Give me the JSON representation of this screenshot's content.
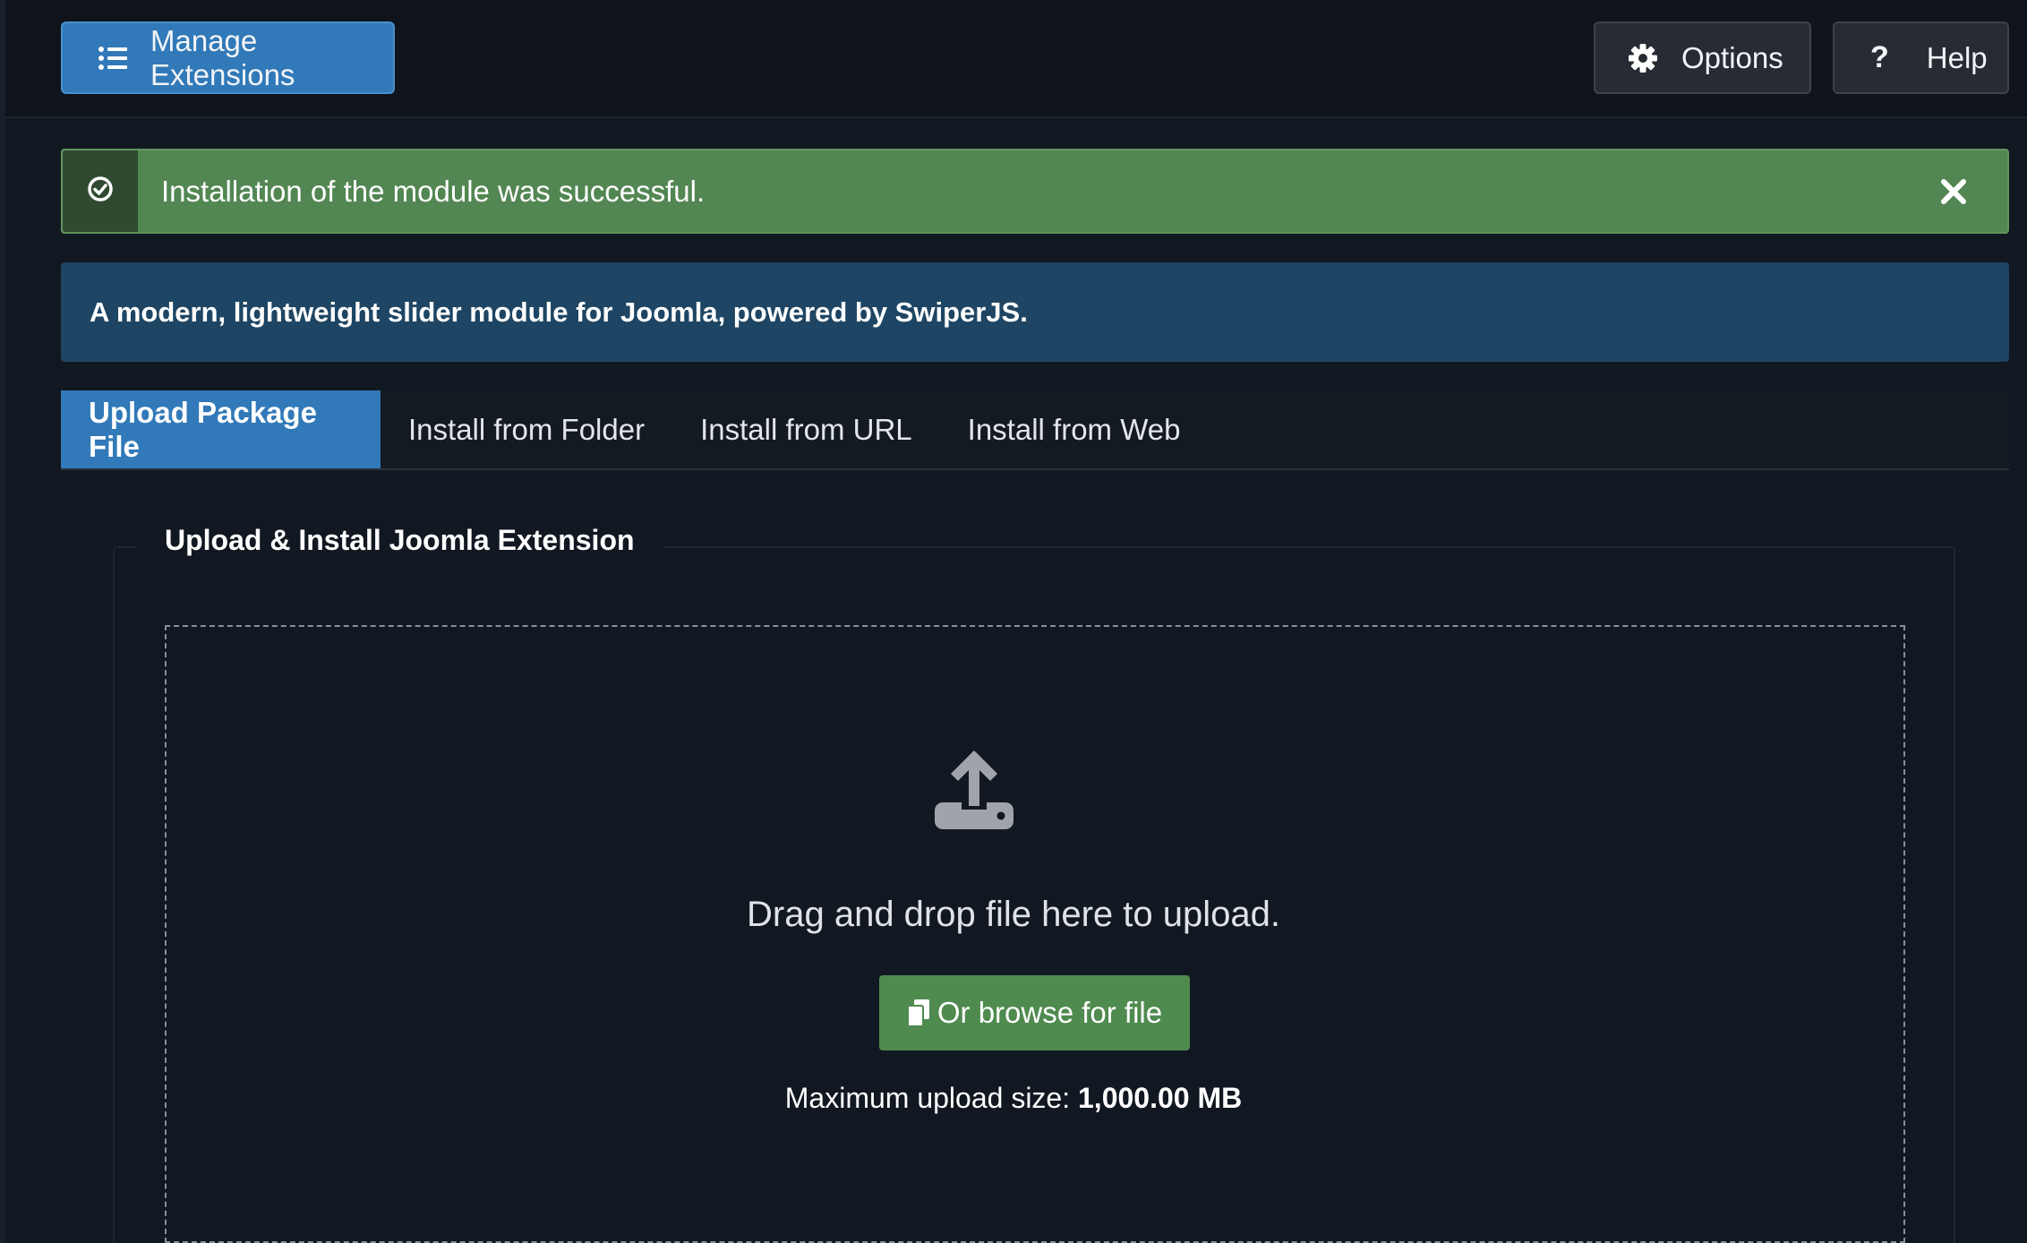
{
  "toolbar": {
    "manage_label": "Manage Extensions",
    "options_label": "Options",
    "help_label": "Help",
    "help_glyph": "?"
  },
  "alert": {
    "message": "Installation of the module was successful.",
    "type": "success",
    "color": "#528652"
  },
  "description": "A modern, lightweight slider module for Joomla, powered by SwiperJS.",
  "tabs": [
    {
      "label": "Upload Package File",
      "active": true
    },
    {
      "label": "Install from Folder",
      "active": false
    },
    {
      "label": "Install from URL",
      "active": false
    },
    {
      "label": "Install from Web",
      "active": false
    }
  ],
  "upload": {
    "legend": "Upload & Install Joomla Extension",
    "drag_text": "Drag and drop file here to upload.",
    "browse_label": "Or browse for file",
    "max_label": "Maximum upload size:",
    "max_value": "1,000.00 MB"
  },
  "icons": {
    "manage": "list-icon",
    "options": "gear-icon",
    "help": "question-icon",
    "alert": "check-circle-icon",
    "close": "close-icon",
    "upload": "upload-icon",
    "browse": "copy-icon"
  },
  "colors": {
    "primary": "#3179b8",
    "success": "#528652",
    "info": "#1e4563",
    "background": "#121821"
  }
}
